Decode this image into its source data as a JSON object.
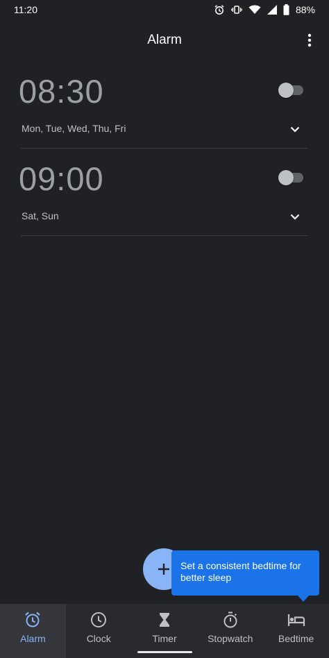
{
  "status_bar": {
    "time": "11:20",
    "battery": "88%",
    "icons": [
      "alarm-icon",
      "vibrate-icon",
      "wifi-icon",
      "signal-icon",
      "battery-icon"
    ]
  },
  "app_bar": {
    "title": "Alarm",
    "overflow_icon": "more-vert-icon"
  },
  "alarms": [
    {
      "time": "08:30",
      "days": "Mon, Tue, Wed, Thu, Fri",
      "enabled": false
    },
    {
      "time": "09:00",
      "days": "Sat, Sun",
      "enabled": false
    }
  ],
  "fab": {
    "icon": "plus-icon"
  },
  "tooltip": {
    "text": "Set a consistent bedtime for better sleep"
  },
  "bottom_nav": {
    "items": [
      {
        "label": "Alarm",
        "icon": "alarm-clock-icon",
        "active": true
      },
      {
        "label": "Clock",
        "icon": "clock-icon",
        "active": false
      },
      {
        "label": "Timer",
        "icon": "hourglass-icon",
        "active": false
      },
      {
        "label": "Stopwatch",
        "icon": "stopwatch-icon",
        "active": false
      },
      {
        "label": "Bedtime",
        "icon": "bed-icon",
        "active": false
      }
    ]
  },
  "colors": {
    "background": "#202124",
    "accent": "#8ab4f8",
    "tooltip": "#1a73e8",
    "nav_background": "#292a2d"
  }
}
